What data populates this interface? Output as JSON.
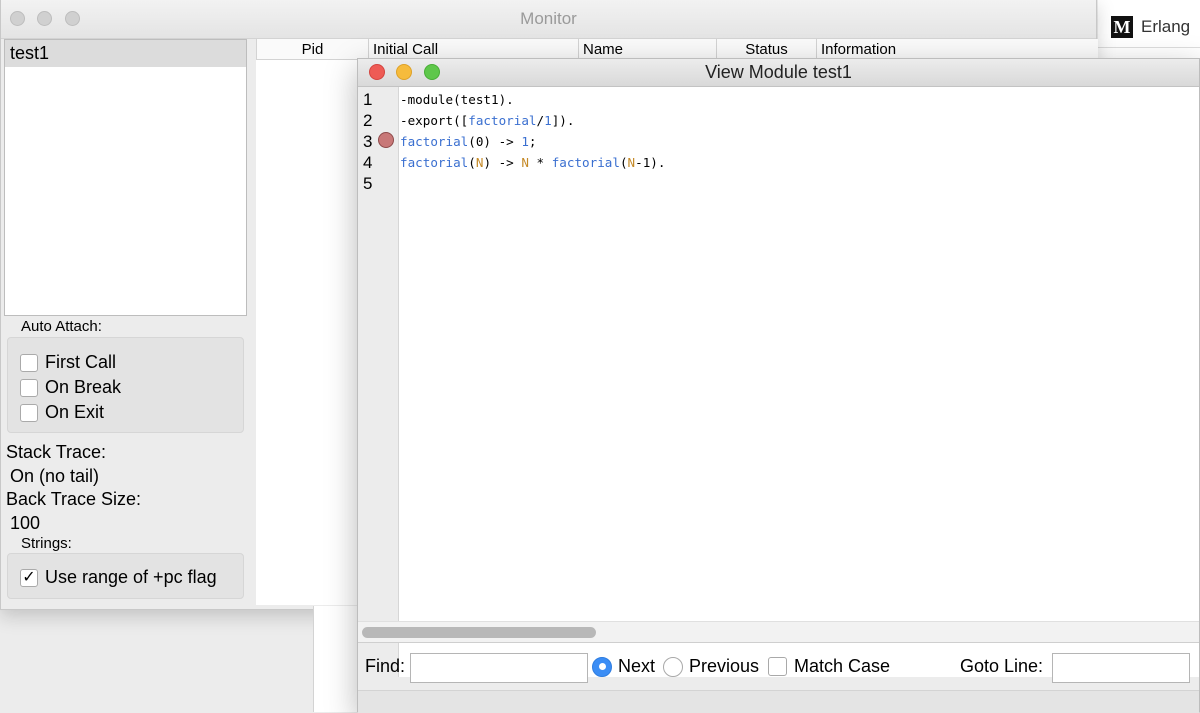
{
  "background_browser": {
    "logo_letter": "M",
    "tab_text": "Erlang"
  },
  "monitor": {
    "title": "Monitor",
    "process_list": [
      "test1"
    ],
    "table_headers": [
      "Pid",
      "Initial Call",
      "Name",
      "Status",
      "Information"
    ],
    "auto_attach": {
      "label": "Auto Attach:",
      "options": [
        {
          "label": "First Call",
          "checked": false
        },
        {
          "label": "On Break",
          "checked": false
        },
        {
          "label": "On Exit",
          "checked": false
        }
      ]
    },
    "stack_trace": {
      "label": "Stack Trace:",
      "value": "On (no tail)"
    },
    "back_trace_size": {
      "label": "Back Trace Size:",
      "value": "100"
    },
    "strings": {
      "label": "Strings:",
      "option": {
        "label": "Use range of +pc flag",
        "checked": true,
        "mark": "✓"
      }
    }
  },
  "view_module": {
    "title": "View Module test1",
    "line_numbers": [
      "1",
      "2",
      "3",
      "4",
      "5"
    ],
    "breakpoint_line": 3,
    "code_lines": [
      [
        {
          "t": "-module(test1)."
        }
      ],
      [
        {
          "t": "-export(["
        },
        {
          "t": "factorial",
          "c": "kw"
        },
        {
          "t": "/"
        },
        {
          "t": "1",
          "c": "kw"
        },
        {
          "t": "])."
        }
      ],
      [
        {
          "t": "factorial",
          "c": "kw"
        },
        {
          "t": "(0) -> "
        },
        {
          "t": "1",
          "c": "kw"
        },
        {
          "t": ";"
        }
      ],
      [
        {
          "t": "factorial",
          "c": "kw"
        },
        {
          "t": "("
        },
        {
          "t": "N",
          "c": "vr"
        },
        {
          "t": ") -> "
        },
        {
          "t": "N",
          "c": "vr"
        },
        {
          "t": " * "
        },
        {
          "t": "factorial",
          "c": "kw"
        },
        {
          "t": "("
        },
        {
          "t": "N",
          "c": "vr"
        },
        {
          "t": "-1)."
        }
      ],
      []
    ],
    "find": {
      "label": "Find:",
      "value": "",
      "next_label": "Next",
      "previous_label": "Previous",
      "selected": "Next",
      "match_case_label": "Match Case",
      "match_case": false,
      "goto_label": "Goto Line:",
      "goto_value": ""
    }
  }
}
